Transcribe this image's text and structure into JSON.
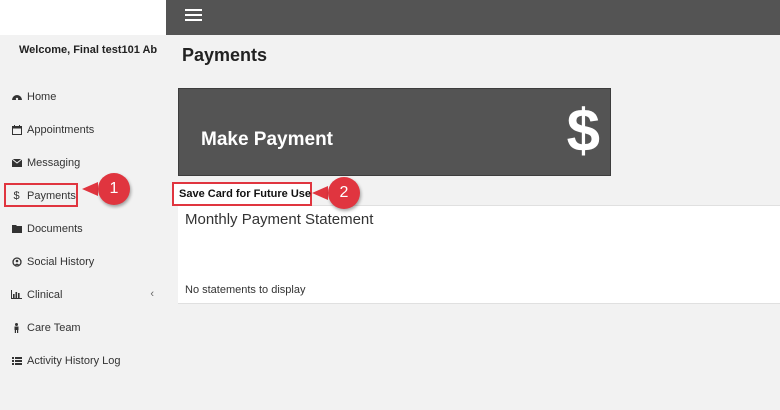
{
  "sidebar": {
    "welcome": "Welcome, Final test101 Ab",
    "items": [
      {
        "label": "Home",
        "icon": "dashboard-icon"
      },
      {
        "label": "Appointments",
        "icon": "calendar-icon"
      },
      {
        "label": "Messaging",
        "icon": "envelope-icon"
      },
      {
        "label": "Payments",
        "icon": "dollar-icon"
      },
      {
        "label": "Documents",
        "icon": "folder-icon"
      },
      {
        "label": "Social History",
        "icon": "social-icon"
      },
      {
        "label": "Clinical",
        "icon": "bar-chart-icon"
      },
      {
        "label": "Care Team",
        "icon": "person-icon"
      },
      {
        "label": "Activity History Log",
        "icon": "list-icon"
      }
    ]
  },
  "main": {
    "title": "Payments",
    "make_payment_label": "Make Payment",
    "dollar_glyph": "$",
    "save_card_label": "Save Card for Future Use",
    "statement_title": "Monthly Payment Statement",
    "statement_empty": "No statements to display"
  },
  "callouts": {
    "one": "1",
    "two": "2"
  },
  "colors": {
    "topbar": "#545454",
    "highlight": "#e0353f"
  }
}
